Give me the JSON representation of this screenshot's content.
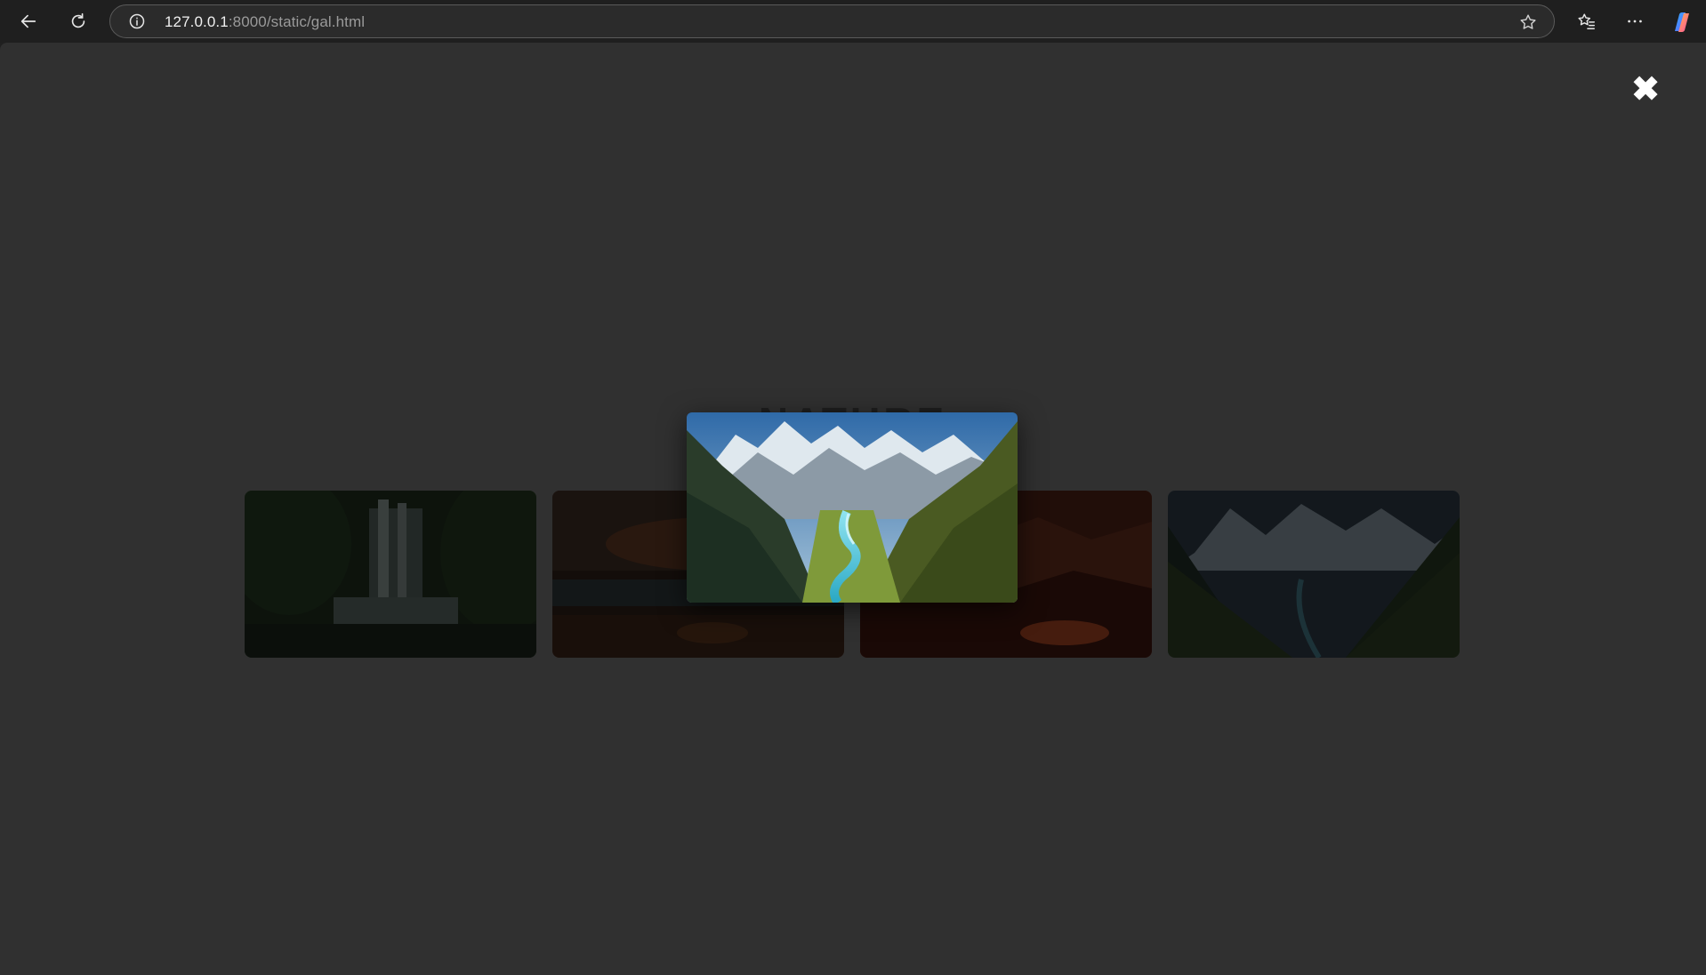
{
  "browser": {
    "url_host": "127.0.0.1",
    "url_rest": ":8000/static/gal.html",
    "icons": [
      "back-arrow-icon",
      "reload-icon",
      "info-icon",
      "favorite-star-icon",
      "favorites-list-icon",
      "more-dots-icon",
      "copilot-icon"
    ]
  },
  "page": {
    "heading": "NATURE",
    "close_label": "✖"
  },
  "gallery": {
    "thumbnails": [
      {
        "name": "waterfall-forest",
        "selected": false
      },
      {
        "name": "sunset-beach",
        "selected": false
      },
      {
        "name": "red-rock-sunset",
        "selected": false
      },
      {
        "name": "mountain-valley-river",
        "selected": false
      }
    ],
    "featured": {
      "name": "mountain-valley-river"
    }
  },
  "colors": {
    "page_bg": "#303030",
    "chrome_bg": "#1f1f1f"
  }
}
